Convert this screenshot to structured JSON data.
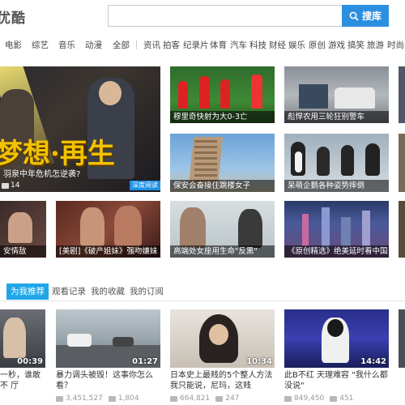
{
  "header": {
    "logo_text": "优酷",
    "search_placeholder": "",
    "search_button_label": "搜库"
  },
  "nav": [
    "电影",
    "综艺",
    "音乐",
    "动漫",
    "全部",
    "资讯",
    "拍客",
    "纪录片",
    "体育",
    "汽车",
    "科技",
    "财经",
    "娱乐",
    "原创",
    "游戏",
    "搞笑",
    "旅游",
    "时尚"
  ],
  "featured": {
    "big": {
      "title_overlay": "梦想·再生",
      "caption": "羽泉中年危机怎逆袭?",
      "badge": "深度阅读",
      "comment_count": "14"
    },
    "tiles": [
      {
        "caption": "穆里奇快射为大0-3亡"
      },
      {
        "caption": "彪悍农用三轮狂别警车"
      },
      {
        "caption": "保安会奋接住跳楼女子"
      },
      {
        "caption": "呆萌企鹅各种姿势摔倒"
      },
      {
        "caption": "安情敌"
      },
      {
        "caption": "[美剧]《破产姐妹》强吻嫌妹"
      },
      {
        "caption": "高端处女座用生命\"反黑\""
      },
      {
        "caption": "《原创精选》绝美延时看中国"
      }
    ]
  },
  "tabs": [
    "为我推荐",
    "观看记录",
    "我的收藏",
    "我的订阅"
  ],
  "videos": [
    {
      "title": "一秒，谁敢不 厅",
      "duration": "00:39",
      "views": "",
      "comments": ""
    },
    {
      "title": "暴力调头被毁！这事你怎么看？",
      "duration": "01:27",
      "views": "3,451,527",
      "comments": "1,804"
    },
    {
      "title": "日本史上最贱的5个整人方法 我只能说，尼玛，这贱",
      "duration": "10:34",
      "views": "664,821",
      "comments": "247"
    },
    {
      "title": "此B不红 天理难容 \"我什么都没说\"",
      "duration": "14:42",
      "views": "849,450",
      "comments": "451"
    },
    {
      "title": "",
      "duration": "",
      "views": "",
      "comments": ""
    }
  ],
  "colors": {
    "accent": "#1ea6e6",
    "search_button": "#2b8fe0"
  }
}
